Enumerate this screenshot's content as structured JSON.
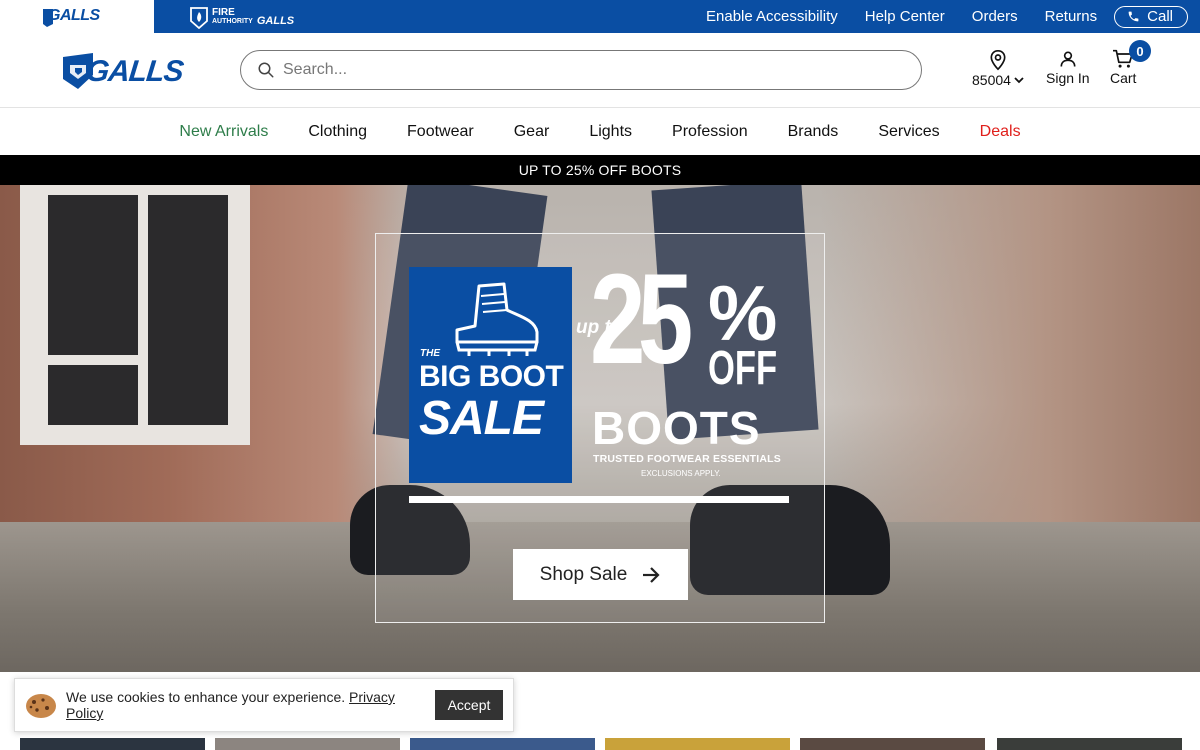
{
  "topbar": {
    "brand_logo": "GALLS",
    "fire_authority": {
      "line1": "FIRE",
      "line2": "AUTHORITY",
      "brand": "GALLS"
    },
    "links": [
      "Enable Accessibility",
      "Help Center",
      "Orders",
      "Returns"
    ],
    "call_label": "Call"
  },
  "header": {
    "logo": "GALLS",
    "search": {
      "placeholder": "Search..."
    },
    "location": {
      "zip": "85004"
    },
    "signin_label": "Sign In",
    "cart_label": "Cart",
    "cart_count": "0"
  },
  "nav": {
    "items": [
      "New Arrivals",
      "Clothing",
      "Footwear",
      "Gear",
      "Lights",
      "Profession",
      "Brands",
      "Services",
      "Deals"
    ]
  },
  "promo_strip": "UP TO 25% OFF BOOTS",
  "hero": {
    "sale_the": "THE",
    "sale_big": "BIG BOOT",
    "sale_sale": "SALE",
    "upto": "up to",
    "percent": "25",
    "percent_sign": "%",
    "off": "OFF",
    "boots": "BOOTS",
    "tagline": "TRUSTED FOOTWEAR ESSENTIALS",
    "exclusions": "EXCLUSIONS APPLY.",
    "cta": "Shop Sale"
  },
  "cookie": {
    "text": "We use cookies to enhance your experience.",
    "link": "Privacy Policy",
    "accept": "Accept"
  },
  "colors": {
    "brand_blue": "#0a4ea3",
    "new_arrivals": "#2e7d4a",
    "deals": "#e0201c"
  }
}
